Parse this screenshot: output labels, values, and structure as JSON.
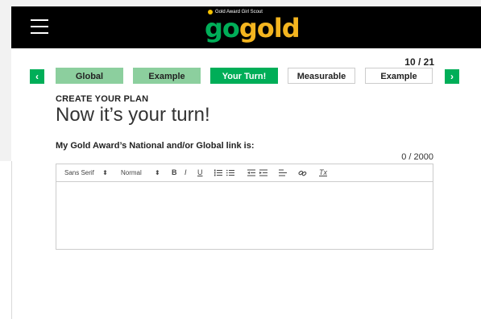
{
  "header": {
    "logo_tagline": "Gold Award Girl Scout",
    "logo_go": "go",
    "logo_gold": "gold",
    "brand_colors": {
      "green": "#00ae58",
      "gold": "#f4b51f",
      "black": "#000000"
    }
  },
  "progress": {
    "text": "10 / 21",
    "current": 10,
    "total": 21
  },
  "nav": {
    "prev_label": "‹",
    "next_label": "›",
    "steps": [
      {
        "label": "Global",
        "state": "completed"
      },
      {
        "label": "Example",
        "state": "completed"
      },
      {
        "label": "Your Turn!",
        "state": "active"
      },
      {
        "label": "Measurable",
        "state": "upcoming"
      },
      {
        "label": "Example",
        "state": "upcoming"
      }
    ]
  },
  "main": {
    "eyebrow": "CREATE YOUR PLAN",
    "title": "Now it’s your turn!",
    "question": "My Gold Award’s National and/or Global link is:",
    "char_counter": "0 / 2000"
  },
  "editor": {
    "font_select": "Sans Serif",
    "size_select": "Normal",
    "bold_label": "B",
    "italic_label": "I",
    "underline_label": "U",
    "clear_format_label": "Tx",
    "value": ""
  }
}
